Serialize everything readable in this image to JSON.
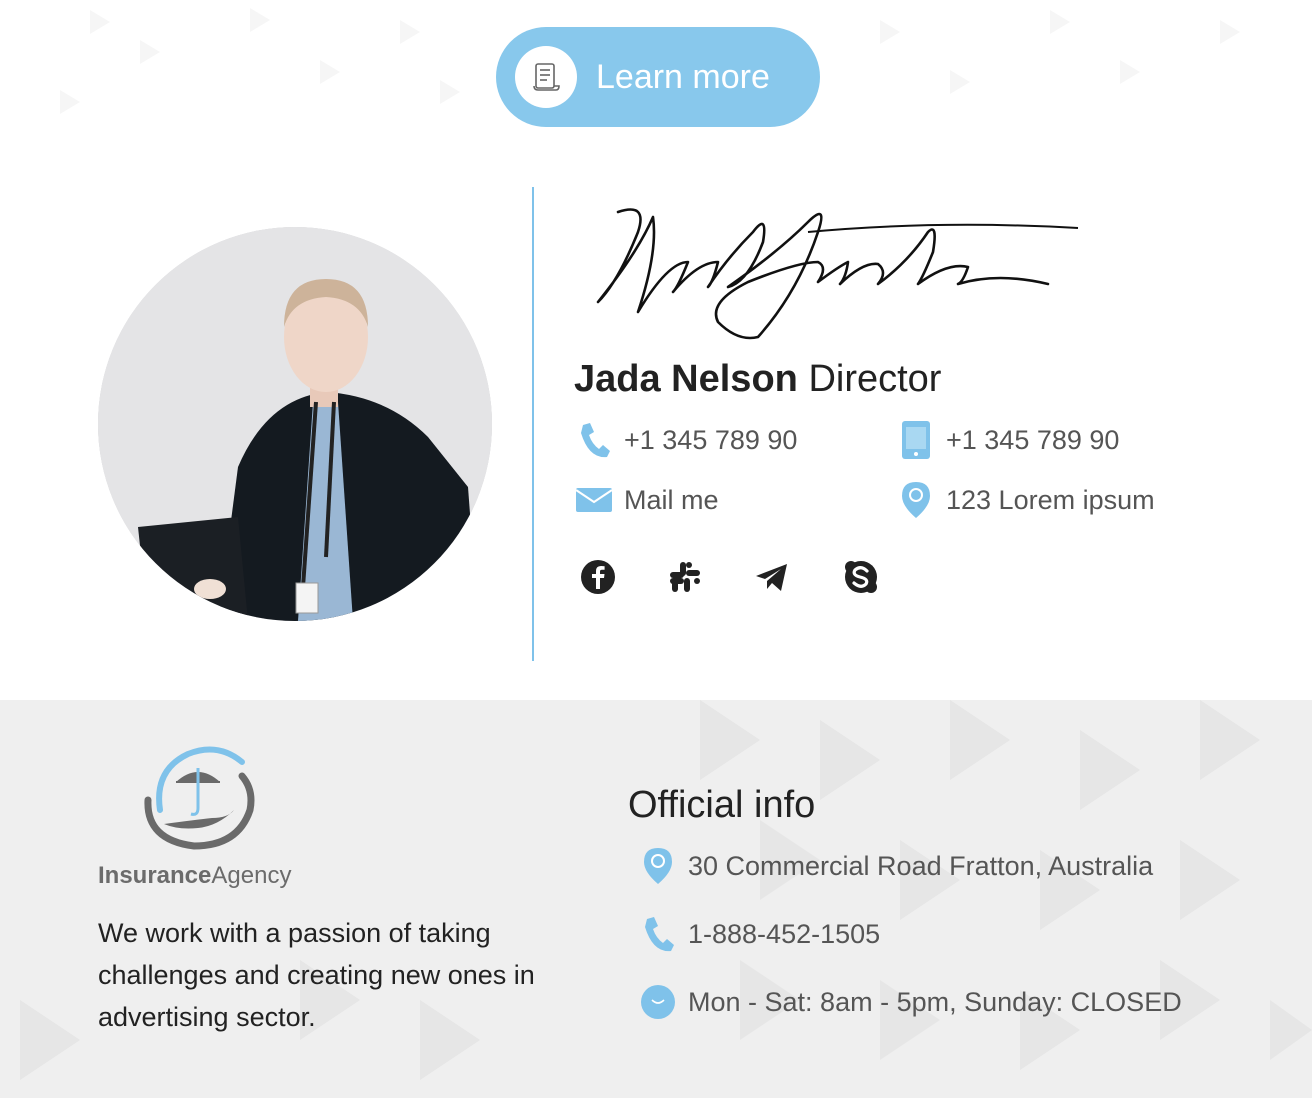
{
  "colors": {
    "accent": "#88c8ec",
    "icon": "#7fc2ea",
    "footer_bg": "#efefef"
  },
  "cta": {
    "label": "Learn more",
    "icon": "document-icon"
  },
  "profile": {
    "name": "Jada Nelson",
    "title": "Director"
  },
  "contacts": {
    "phone": "+1 345 789 90",
    "mobile": "+1 345 789 90",
    "email_label": "Mail me",
    "address": "123 Lorem ipsum"
  },
  "social": [
    "facebook-icon",
    "slack-icon",
    "telegram-icon",
    "skype-icon"
  ],
  "company": {
    "logo_bold": "Insurance",
    "logo_regular": "Agency",
    "description": "We work with a passion of taking challenges and creating new ones in advertising sector."
  },
  "official": {
    "title": "Official info",
    "address": "30 Commercial Road Fratton, Australia",
    "phone": "1-888-452-1505",
    "hours": "Mon - Sat: 8am - 5pm, Sunday: CLOSED"
  }
}
